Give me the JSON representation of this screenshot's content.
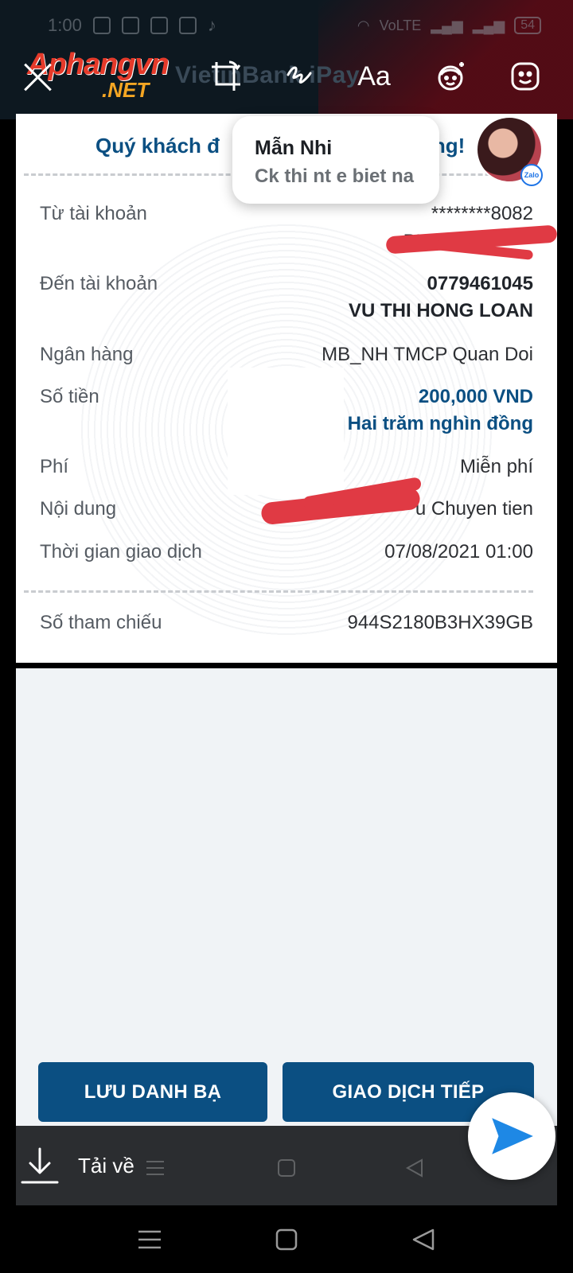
{
  "status_bar": {
    "time": "1:00",
    "network": "VoLTE",
    "battery": "54"
  },
  "editor": {
    "watermark": "Aphangvn",
    "watermark_suffix": ".NET",
    "background_title": "VietinBank iPay",
    "text_tool_label": "Aa",
    "tools": [
      "close-icon",
      "crop-rotate-icon",
      "draw-icon",
      "text-icon",
      "face-filter-icon",
      "sticker-icon"
    ]
  },
  "notification": {
    "sender": "Mẫn Nhi",
    "message": "Ck thi nt e biet na"
  },
  "receipt": {
    "heading": "Quý khách đ",
    "heading_tail": "ông!",
    "rows": {
      "from_account": {
        "label": "Từ tài khoản",
        "value": "********8082",
        "value2": "PH"
      },
      "to_account": {
        "label": "Đến tài khoản",
        "value": "0779461045",
        "value2": "VU THI HONG LOAN"
      },
      "bank": {
        "label": "Ngân hàng",
        "value": "MB_NH TMCP Quan Doi"
      },
      "amount": {
        "label": "Số tiền",
        "value": "200,000 VND",
        "value2": "Hai trăm nghìn đồng"
      },
      "fee": {
        "label": "Phí",
        "value": "Miễn phí"
      },
      "content": {
        "label": "Nội dung",
        "value": "u Chuyen tien"
      },
      "time": {
        "label": "Thời gian giao dịch",
        "value": "07/08/2021 01:00"
      },
      "reference": {
        "label": "Số tham chiếu",
        "value": "944S2180B3HX39GB"
      }
    }
  },
  "buttons": {
    "save_contact": "LƯU DANH BẠ",
    "next_transaction": "GIAO DỊCH TIẾP"
  },
  "bottom": {
    "download_label": "Tải về"
  },
  "colors": {
    "brand_blue": "#0b4f82",
    "scribble_red": "#e03a44",
    "send_blue": "#1e88e5"
  }
}
